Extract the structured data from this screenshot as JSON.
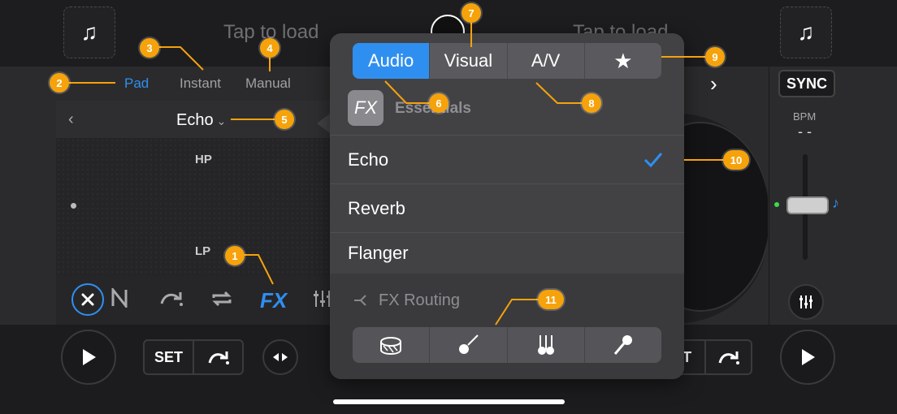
{
  "top": {
    "left_load": "Tap to load",
    "right_load": "Tap to load",
    "music_icon": "♫"
  },
  "mode_tabs": {
    "pad": "Pad",
    "instant": "Instant",
    "manual": "Manual"
  },
  "fx_panel": {
    "effect": "Echo",
    "hp": "HP",
    "lp": "LP"
  },
  "right_panel": {
    "sync": "SYNC",
    "bpm_label": "BPM",
    "bpm_value": "- -"
  },
  "bottom": {
    "set": "SET",
    "set_right": "T"
  },
  "popup": {
    "tabs": [
      "Audio",
      "Visual",
      "A/V",
      "★"
    ],
    "category": "Essentials",
    "fx_badge": "FX",
    "items": [
      "Echo",
      "Reverb",
      "Flanger"
    ],
    "routing": "FX Routing"
  },
  "callouts": [
    "1",
    "2",
    "3",
    "4",
    "5",
    "6",
    "7",
    "8",
    "9",
    "10",
    "11"
  ],
  "colors": {
    "accent": "#2f8ff0",
    "callout": "#f5a20b"
  }
}
